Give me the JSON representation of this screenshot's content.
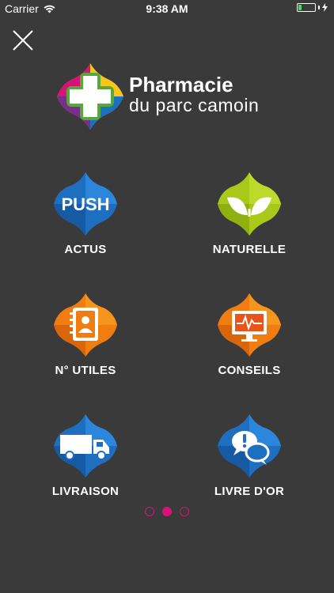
{
  "status_bar": {
    "carrier": "Carrier",
    "time": "9:38 AM",
    "battery_level": 0.2
  },
  "header": {
    "close_icon": "close-icon",
    "brand_name": "Pharmacie",
    "brand_subtitle": "du parc camoin"
  },
  "menu": {
    "items": [
      {
        "label": "ACTUS",
        "icon": "push-icon",
        "accent": "#1f6fc0"
      },
      {
        "label": "NATURELLE",
        "icon": "leaves-icon",
        "accent": "#a9c81a"
      },
      {
        "label": "N° UTILES",
        "icon": "contacts-book-icon",
        "accent": "#f07c12"
      },
      {
        "label": "CONSEILS",
        "icon": "monitor-heartbeat-icon",
        "accent": "#f07c12"
      },
      {
        "label": "LIVRAISON",
        "icon": "delivery-truck-icon",
        "accent": "#1f6fc0"
      },
      {
        "label": "LIVRE D'OR",
        "icon": "chat-bubbles-icon",
        "accent": "#1f6fc0"
      }
    ],
    "push_badge_text": "PUSH"
  },
  "pager": {
    "pages": 3,
    "current": 2,
    "accent": "#d9127a"
  }
}
